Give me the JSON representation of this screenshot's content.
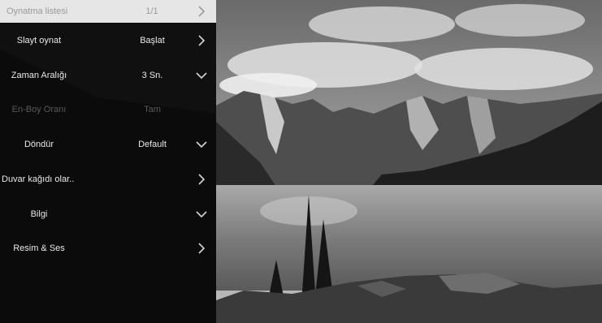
{
  "background": {
    "description_icon": "mountain-lake-photo"
  },
  "menu": {
    "items": [
      {
        "label": "Oynatma listesi",
        "value": "1/1",
        "arrow": "chevron-right-icon",
        "state": "selected"
      },
      {
        "label": "Slayt oynat",
        "value": "Başlat",
        "arrow": "chevron-right-icon",
        "state": "normal"
      },
      {
        "label": "Zaman Aralığı",
        "value": "3 Sn.",
        "arrow": "chevron-down-icon",
        "state": "normal"
      },
      {
        "label": "En-Boy Oranı",
        "value": "Tam",
        "arrow": "",
        "state": "disabled"
      },
      {
        "label": "Döndür",
        "value": "Default",
        "arrow": "chevron-down-icon",
        "state": "normal"
      },
      {
        "label": "Duvar kağıdı olar..",
        "value": "",
        "arrow": "chevron-right-icon",
        "state": "normal"
      },
      {
        "label": "Bilgi",
        "value": "",
        "arrow": "chevron-down-icon",
        "state": "normal"
      },
      {
        "label": "Resim & Ses",
        "value": "",
        "arrow": "chevron-right-icon",
        "state": "normal"
      }
    ]
  },
  "colors": {
    "selected_bg": "#e6e6e6",
    "text": "#e9e9e9",
    "disabled_text": "#5a5a5a"
  }
}
